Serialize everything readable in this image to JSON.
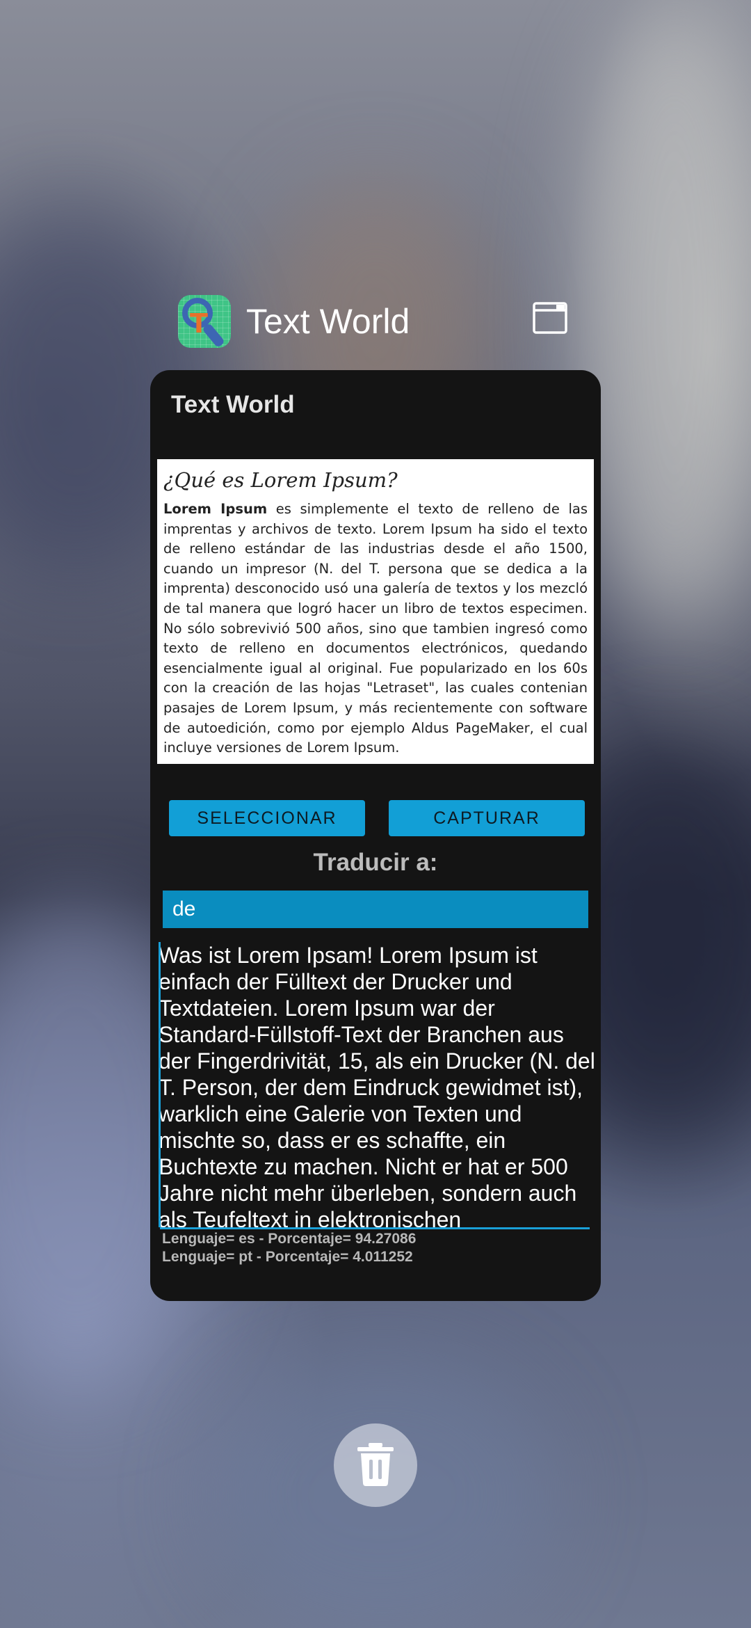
{
  "recents": {
    "app_name": "Text World",
    "icon_letter": "T"
  },
  "app": {
    "title": "Text World",
    "source": {
      "heading": "¿Qué es Lorem Ipsum?",
      "bold_lead": "Lorem Ipsum",
      "body": " es simplemente el texto de relleno de las imprentas y archivos de texto. Lorem Ipsum ha sido el texto de relleno estándar de las industrias desde el año 1500, cuando un impresor (N. del T. persona que se dedica a la imprenta) desconocido usó una galería de textos y los mezcló de tal manera que logró hacer un libro de textos especimen. No sólo sobrevivió 500 años, sino que tambien ingresó como texto de relleno en documentos electrónicos, quedando esencialmente igual al original. Fue popularizado en los 60s con la creación de las hojas \"Letraset\", las cuales contenian pasajes de Lorem Ipsum, y más recientemente con software de autoedición, como por ejemplo Aldus PageMaker, el cual incluye versiones de Lorem Ipsum."
    },
    "buttons": {
      "select": "SELECCIONAR",
      "capture": "CAPTURAR"
    },
    "translate_label": "Traducir a:",
    "target_language": "de",
    "translated_text": "Was ist Lorem Ipsam! Lorem Ipsum ist einfach der Fülltext der Drucker und Textdateien. Lorem Ipsum war der Standard-Füllstoff-Text der Branchen aus der Fingerdrivität, 15, als ein Drucker (N. del T. Person, der dem Eindruck gewidmet ist), warklich eine Galerie von Texten und mischte so, dass er es schaffte, ein Buchtexte zu machen. Nicht er hat er 500 Jahre nicht mehr überleben, sondern auch als Teufeltext in elektronischen",
    "detected": [
      "Lenguaje= es - Porcentaje= 94.27086",
      "Lenguaje= pt - Porcentaje= 4.011252"
    ]
  },
  "colors": {
    "accent": "#129fd6",
    "card_background": "#141414",
    "icon_green": "#3fc486",
    "icon_blue": "#3d66b3",
    "icon_orange": "#e8702a"
  },
  "icons": {
    "window": "window-icon",
    "delete": "trash-icon"
  }
}
